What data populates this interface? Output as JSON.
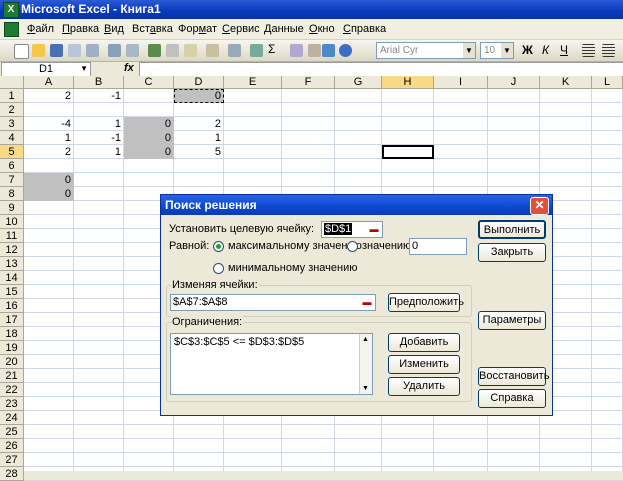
{
  "window": {
    "title": "Microsoft Excel - Книга1",
    "app_icon": "X"
  },
  "menu": [
    {
      "pre": "",
      "ul": "Ф",
      "post": "айл"
    },
    {
      "pre": "",
      "ul": "П",
      "post": "равка"
    },
    {
      "pre": "",
      "ul": "В",
      "post": "ид"
    },
    {
      "pre": "Вст",
      "ul": "а",
      "post": "вка"
    },
    {
      "pre": "Фор",
      "ul": "м",
      "post": "ат"
    },
    {
      "pre": "",
      "ul": "С",
      "post": "ервис"
    },
    {
      "pre": "",
      "ul": "Д",
      "post": "анные"
    },
    {
      "pre": "",
      "ul": "О",
      "post": "кно"
    },
    {
      "pre": "",
      "ul": "С",
      "post": "правка"
    }
  ],
  "toolbar": {
    "font_name": "Arial Cyr",
    "font_size": "10",
    "bold": "Ж",
    "italic": "К",
    "underline": "Ч",
    "sum": "Σ"
  },
  "formula_bar": {
    "name_box": "D1",
    "fx": "fx",
    "formula": ""
  },
  "columns": [
    "A",
    "B",
    "C",
    "D",
    "E",
    "F",
    "G",
    "H",
    "I",
    "J",
    "K",
    "L"
  ],
  "selected_column": "H",
  "rows": [
    "1",
    "2",
    "3",
    "4",
    "5",
    "6",
    "7",
    "8",
    "9",
    "10",
    "11",
    "12",
    "13",
    "14",
    "15",
    "16",
    "17",
    "18",
    "19",
    "20",
    "21",
    "22",
    "23",
    "24",
    "25",
    "26",
    "27",
    "28"
  ],
  "selected_row": "5",
  "cells": {
    "A1": "2",
    "B1": "-1",
    "D1": "0",
    "A3": "-4",
    "B3": "1",
    "C3": "0",
    "D3": "2",
    "A4": "1",
    "B4": "-1",
    "C4": "0",
    "D4": "1",
    "A5": "2",
    "B5": "1",
    "C5": "0",
    "D5": "5",
    "A7": "0",
    "A8": "0"
  },
  "dialog": {
    "title": "Поиск решения",
    "target_label": "Установить целевую ячейку:",
    "target_value": "$D$1",
    "equal_label": "Равной:",
    "opt_max": "максимальному значению",
    "opt_value": "значению:",
    "value_input": "0",
    "opt_min": "минимальному значению",
    "changing_label": "Изменяя ячейки:",
    "changing_value": "$A$7:$A$8",
    "guess_button": "Предположить",
    "constraints_label": "Ограничения:",
    "constraints": [
      "$C$3:$C$5 <= $D$3:$D$5"
    ],
    "add_button": "Добавить",
    "change_button": "Изменить",
    "delete_button": "Удалить",
    "solve_button": "Выполнить",
    "close_button": "Закрыть",
    "options_button": "Параметры",
    "reset_button": "Восстановить",
    "help_button": "Справка"
  }
}
